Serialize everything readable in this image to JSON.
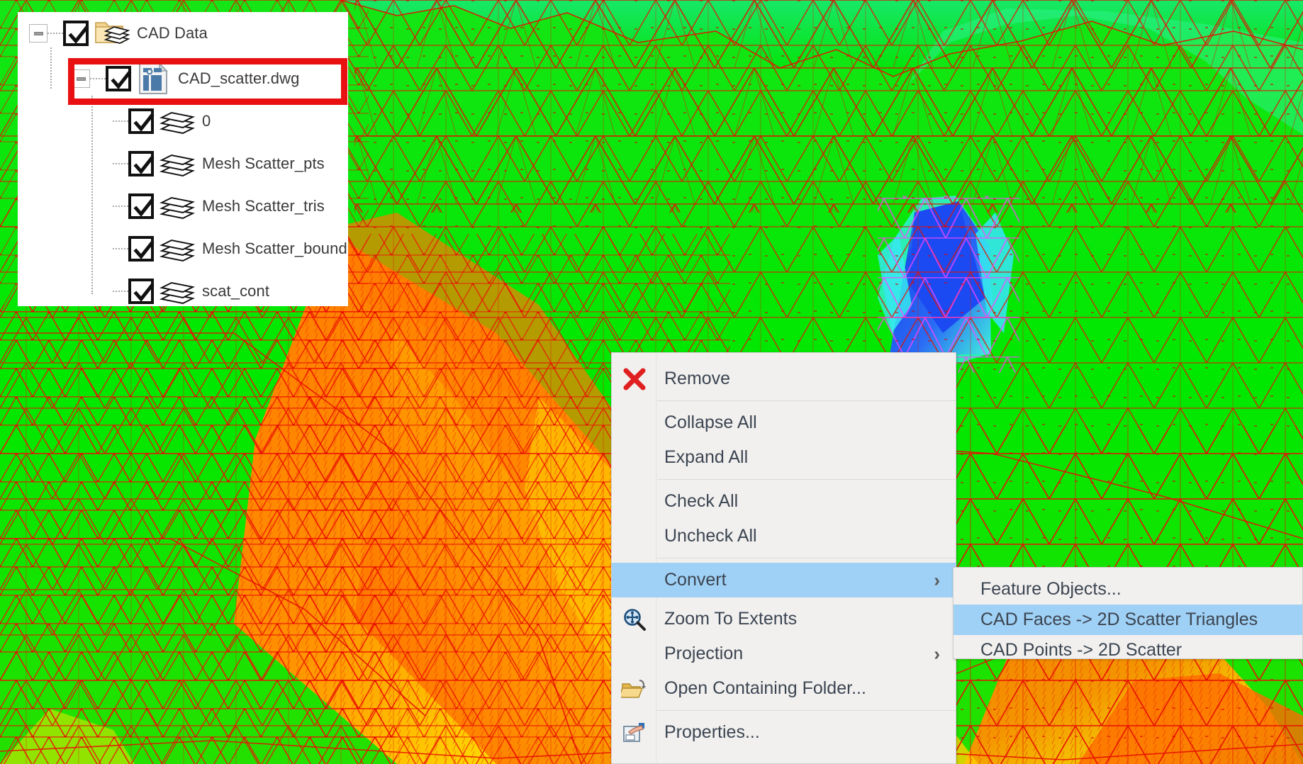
{
  "app": {
    "scene_description": "3D triangulated terrain mesh (TIN) colored by elevation, red triangle edges"
  },
  "tree": {
    "items": [
      {
        "label": "CAD Data",
        "icon": "folder-layers-icon",
        "checked": true,
        "expander": "minus",
        "depth": 0
      },
      {
        "label": "CAD_scatter.dwg",
        "icon": "dwg-file-icon",
        "checked": true,
        "expander": "minus",
        "depth": 1,
        "highlighted": true
      },
      {
        "label": "0",
        "icon": "layers-icon",
        "checked": true,
        "expander": "none",
        "depth": 2
      },
      {
        "label": "Mesh Scatter_pts",
        "icon": "layers-icon",
        "checked": true,
        "expander": "none",
        "depth": 2
      },
      {
        "label": "Mesh Scatter_tris",
        "icon": "layers-icon",
        "checked": true,
        "expander": "none",
        "depth": 2
      },
      {
        "label": "Mesh Scatter_bound",
        "icon": "layers-icon",
        "checked": true,
        "expander": "none",
        "depth": 2
      },
      {
        "label": "scat_cont",
        "icon": "layers-icon",
        "checked": true,
        "expander": "none",
        "depth": 2
      }
    ]
  },
  "context_menu": {
    "items": [
      {
        "label": "Remove",
        "icon": "red-x-icon",
        "selected": false,
        "submenu": false,
        "separator_after": true
      },
      {
        "label": "Collapse All",
        "icon": "none",
        "selected": false,
        "submenu": false,
        "separator_after": false
      },
      {
        "label": "Expand All",
        "icon": "none",
        "selected": false,
        "submenu": false,
        "separator_after": true
      },
      {
        "label": "Check All",
        "icon": "none",
        "selected": false,
        "submenu": false,
        "separator_after": false
      },
      {
        "label": "Uncheck All",
        "icon": "none",
        "selected": false,
        "submenu": false,
        "separator_after": true
      },
      {
        "label": "Convert",
        "icon": "none",
        "selected": true,
        "submenu": true,
        "separator_after": false
      },
      {
        "label": "Zoom To Extents",
        "icon": "zoom-extents-icon",
        "selected": false,
        "submenu": false,
        "separator_after": false
      },
      {
        "label": "Projection",
        "icon": "none",
        "selected": false,
        "submenu": true,
        "separator_after": false
      },
      {
        "label": "Open Containing Folder...",
        "icon": "open-folder-icon",
        "selected": false,
        "submenu": false,
        "separator_after": true
      },
      {
        "label": "Properties...",
        "icon": "properties-icon",
        "selected": false,
        "submenu": false,
        "separator_after": false
      }
    ]
  },
  "sub_menu": {
    "items": [
      {
        "label": "Feature Objects...",
        "selected": false
      },
      {
        "label": "CAD Faces -> 2D Scatter Triangles",
        "selected": true
      },
      {
        "label": "CAD Points -> 2D Scatter",
        "selected": false
      }
    ]
  },
  "colors": {
    "highlight_rect": "#e81010",
    "menu_selection": "#9fd0f5",
    "menu_background": "#f1f0ef",
    "menu_text": "#3c4551",
    "tree_text": "#3a3a3a",
    "mesh_edge": "#ee0000",
    "terrain_green": "#00e000",
    "terrain_orange": "#ff6a00",
    "terrain_yellow": "#ffe000",
    "terrain_blue": "#1a4ef0",
    "terrain_cyan": "#30e8f0"
  }
}
